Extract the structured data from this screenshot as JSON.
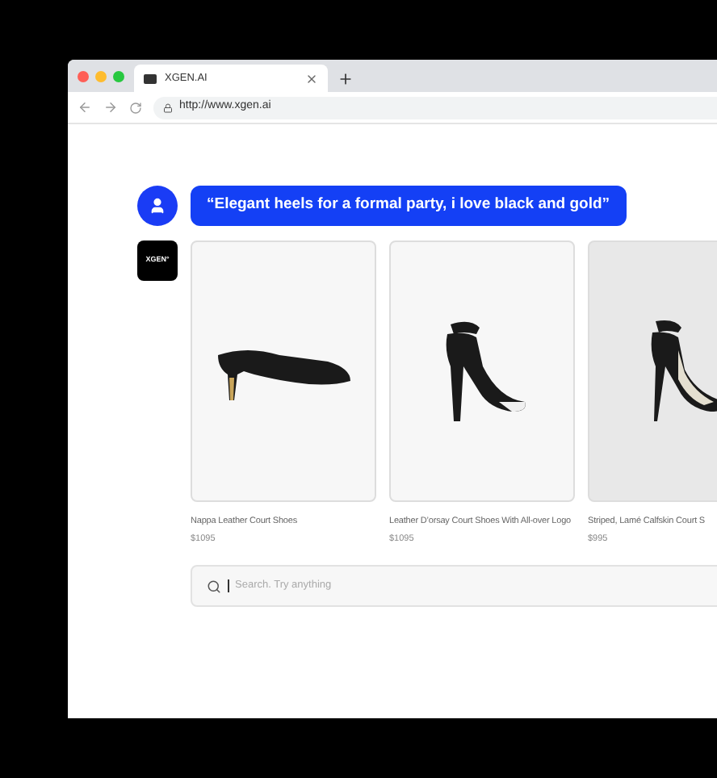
{
  "browser": {
    "tab_title": "XGEN.AI",
    "url": "http://www.xgen.ai"
  },
  "chat": {
    "user_message": "“Elegant heels for a formal party, i love black and gold”",
    "bot_logo": "XGEN°"
  },
  "products": [
    {
      "kind": "pump",
      "name": "Nappa Leather Court Shoes",
      "price": "$1095"
    },
    {
      "kind": "ankle-strap",
      "name": "Leather D’orsay Court Shoes With All-over Logo",
      "price": "$1095"
    },
    {
      "kind": "stiletto",
      "name": "Striped, Lamé Calfskin Court S",
      "price": "$995"
    }
  ],
  "search": {
    "placeholder": "Search. Try anything"
  }
}
